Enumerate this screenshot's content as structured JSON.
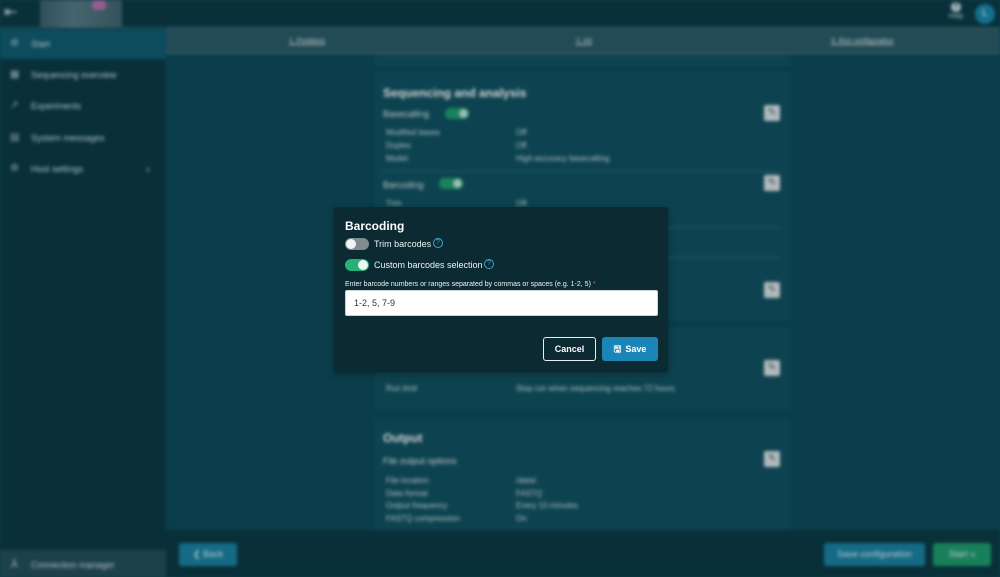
{
  "topbar": {
    "help_label": "Help",
    "avatar_initial": "L"
  },
  "sidebar": {
    "items": [
      {
        "label": "Start",
        "icon": "gear-icon"
      },
      {
        "label": "Sequencing overview",
        "icon": "grid-icon"
      },
      {
        "label": "Experiments",
        "icon": "chart-line-icon"
      },
      {
        "label": "System messages",
        "icon": "message-icon"
      },
      {
        "label": "Host settings",
        "icon": "gear-icon"
      }
    ],
    "connection_manager": "Connection manager"
  },
  "steps": [
    "1. Positions",
    "2. Kit",
    "3. Run configuration"
  ],
  "background": {
    "seq_title": "Sequencing and analysis",
    "basecalling": {
      "label": "Basecalling",
      "rows": [
        {
          "k": "Modified bases",
          "v": "Off"
        },
        {
          "k": "Duplex",
          "v": "Off"
        },
        {
          "k": "Model",
          "v": "High-accuracy basecalling"
        }
      ]
    },
    "barcoding": {
      "label": "Barcoding",
      "rows": [
        {
          "k": "Trim",
          "v": "Off"
        }
      ]
    },
    "run_limit": {
      "k": "Run limit",
      "v": "Stop run when sequencing reaches 72 hours"
    },
    "output": {
      "title": "Output",
      "section": "File output options",
      "rows": [
        {
          "k": "File location",
          "v": "/data/."
        },
        {
          "k": "Data format",
          "v": "FASTQ"
        },
        {
          "k": "Output frequency",
          "v": "Every 10 minutes"
        },
        {
          "k": "FASTQ compression",
          "v": "On"
        }
      ]
    }
  },
  "footer": {
    "back": "Back",
    "save_config": "Save configuration",
    "start": "Start"
  },
  "modal": {
    "title": "Barcoding",
    "trim_label": "Trim barcodes",
    "trim_on": false,
    "custom_label": "Custom barcodes selection",
    "custom_on": true,
    "field_label": "Enter barcode numbers or ranges separated by commas or spaces (e.g. 1-2, 5)",
    "field_required": "*",
    "field_value": "1-2, 5, 7-9",
    "cancel": "Cancel",
    "save": "Save"
  }
}
